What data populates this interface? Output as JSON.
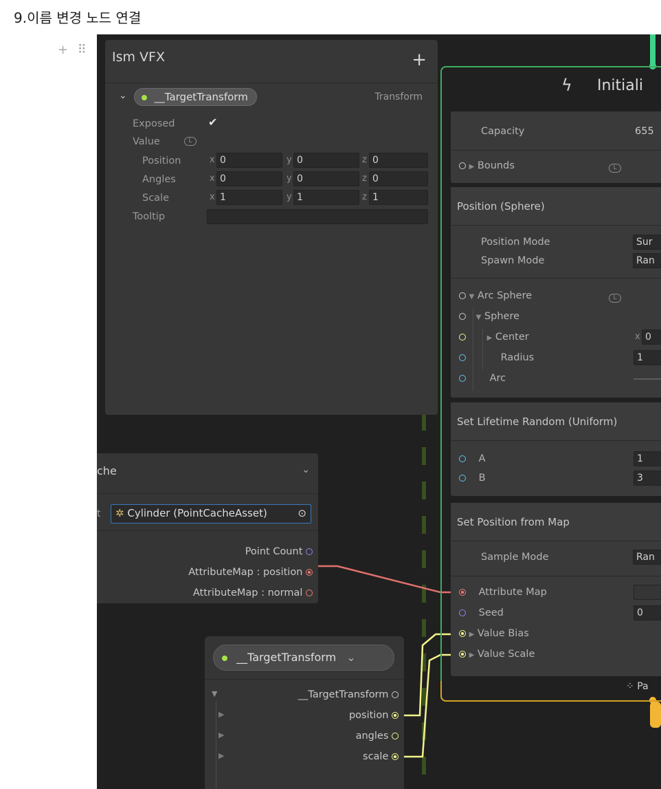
{
  "page": {
    "title": "9.이름 변경 노드 연결",
    "block_handle": "+ ⠿"
  },
  "blackboard": {
    "title": "Ism VFX",
    "add_label": "+",
    "property": {
      "name": "__TargetTransform",
      "type": "Transform",
      "exposed_label": "Exposed",
      "exposed_checked": true,
      "value_label": "Value",
      "position_label": "Position",
      "angles_label": "Angles",
      "scale_label": "Scale",
      "tooltip_label": "Tooltip",
      "position": {
        "x": "0",
        "y": "0",
        "z": "0"
      },
      "angles": {
        "x": "0",
        "y": "0",
        "z": "0"
      },
      "scale": {
        "x": "1",
        "y": "1",
        "z": "1"
      }
    }
  },
  "point_cache": {
    "title": "che",
    "asset_prefix": "t",
    "asset": "Cylinder (PointCacheAsset)",
    "outputs": [
      "Point Count",
      "AttributeMap : position",
      "AttributeMap : normal"
    ]
  },
  "target_transform_op": {
    "title": "__TargetTransform",
    "outputs": [
      "__TargetTransform",
      "position",
      "angles",
      "scale"
    ]
  },
  "context": {
    "title": "Initiali",
    "capacity_label": "Capacity",
    "capacity_value": "655",
    "bounds_label": "Bounds",
    "position_sphere": {
      "title": "Position (Sphere)",
      "position_mode_label": "Position Mode",
      "position_mode_value": "Sur",
      "spawn_mode_label": "Spawn Mode",
      "spawn_mode_value": "Ran",
      "arc_sphere_label": "Arc Sphere",
      "sphere_label": "Sphere",
      "center_label": "Center",
      "center_value": "0",
      "radius_label": "Radius",
      "radius_value": "1",
      "arc_label": "Arc"
    },
    "lifetime": {
      "title": "Set Lifetime Random (Uniform)",
      "a_label": "A",
      "a_value": "1",
      "b_label": "B",
      "b_value": "3"
    },
    "position_map": {
      "title": "Set Position from Map",
      "sample_mode_label": "Sample Mode",
      "sample_mode_value": "Ran",
      "attribute_map_label": "Attribute Map",
      "seed_label": "Seed",
      "seed_value": "0",
      "value_bias_label": "Value Bias",
      "value_scale_label": "Value Scale"
    },
    "footer_label": "Pa"
  },
  "colors": {
    "canvas": "#202020",
    "panel": "#373737",
    "spawn_flow": "#3fae61",
    "update_flow": "#d4a220",
    "vector_port": "#f3f38c",
    "attribute_map_port": "#f07a73",
    "float_port": "#5fc0e8",
    "uint_port": "#8d85f0",
    "exposed_dot": "#a6e24a"
  }
}
